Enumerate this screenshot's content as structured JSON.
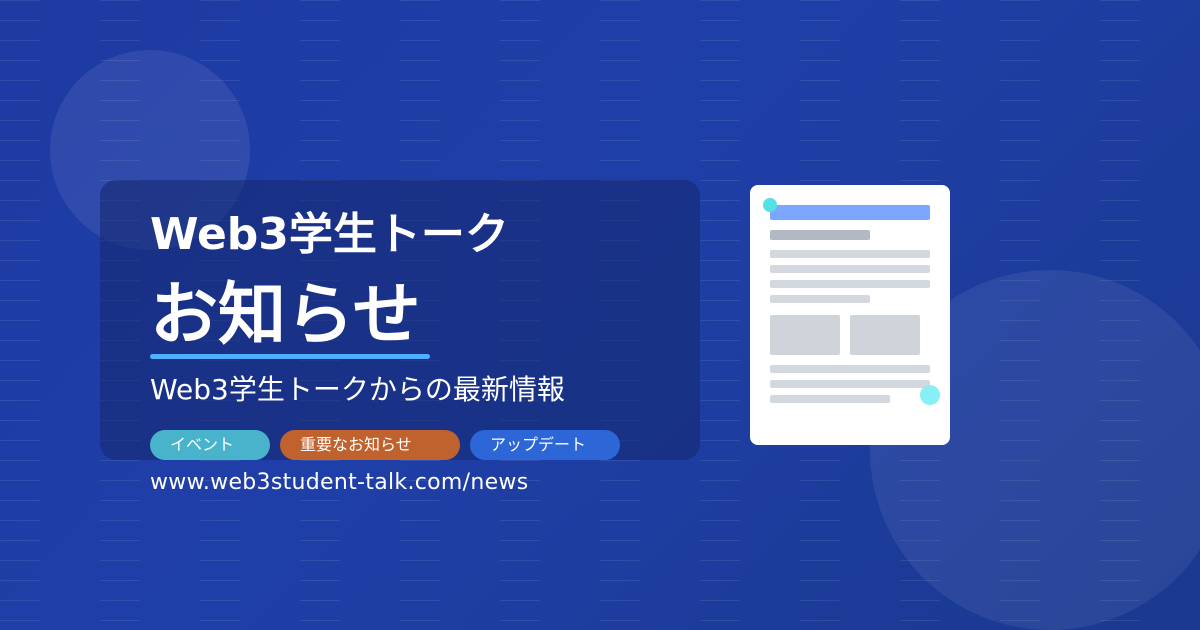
{
  "header": {
    "brand": "Web3学生トーク",
    "headline": "お知らせ",
    "subtitle": "Web3学生トークからの最新情報"
  },
  "tags": [
    {
      "label": "イベント",
      "color": "#4ab3cc"
    },
    {
      "label": "重要なお知らせ",
      "color": "#c0622e"
    },
    {
      "label": "アップデート",
      "color": "#2d66d6"
    }
  ],
  "footer": {
    "url": "www.web3student-talk.com/news"
  },
  "colors": {
    "background": "#1e3aa3",
    "accent_underline": "#4fb0ff",
    "doc_header": "#7ba7ff",
    "dot": "#55e0e6"
  },
  "illustration": {
    "icon": "document-icon"
  }
}
